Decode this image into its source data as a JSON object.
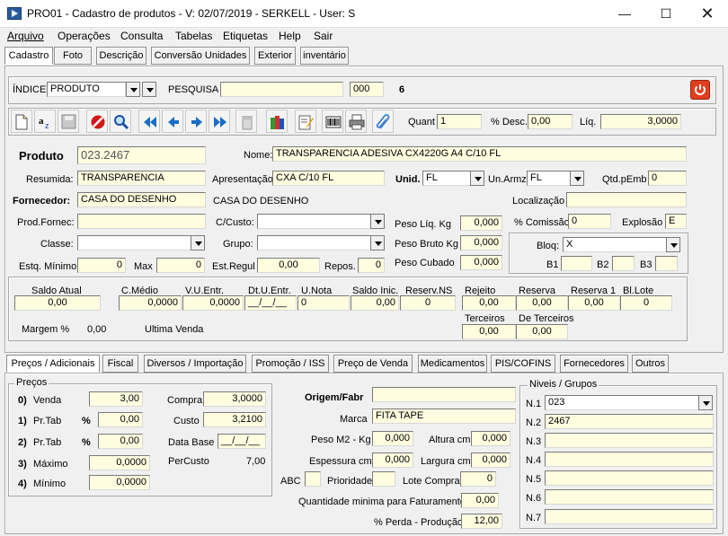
{
  "window": {
    "title": "PRO01 - Cadastro de produtos - V: 02/07/2019 - SERKELL - User: S"
  },
  "menu": [
    "Arquivo",
    "Operações",
    "Consulta",
    "Tabelas",
    "Etiquetas",
    "Help",
    "Sair"
  ],
  "top_tabs": [
    "Cadastro",
    "Foto",
    "Descrição",
    "Conversão Unidades",
    "Exterior",
    "inventário"
  ],
  "index_bar": {
    "indice_label": "ÍNDICE",
    "indice_value": "PRODUTO",
    "pesquisa_label": "PESQUISA",
    "pesquisa_value": "",
    "code_value": "000",
    "count": "6"
  },
  "toolbar": {
    "quant_label": "Quant",
    "quant_value": "1",
    "desc_label": "% Desc.",
    "desc_value": "0,00",
    "liq_label": "Líq.",
    "liq_value": "3,0000"
  },
  "product": {
    "produto_label": "Produto",
    "produto_value": "023.2467",
    "nome_label": "Nome:",
    "nome_value": "TRANSPARENCIA ADESIVA CX4220G A4 C/10 FL",
    "resumida_label": "Resumida:",
    "resumida_value": "TRANSPARENCIA",
    "apresentacao_label": "Apresentação",
    "apresentacao_value": "CXA C/10 FL",
    "unid_label": "Unid.",
    "unid_value": "FL",
    "unarmz_label": "Un.Armz",
    "unarmz_value": "FL",
    "qtdemb_label": "Qtd.pEmb",
    "qtdemb_value": "0",
    "fornecedor_label": "Fornecedor:",
    "fornecedor_value": "CASA DO DESENHO",
    "fornecedor_name": "CASA DO DESENHO",
    "localizacao_label": "Localização",
    "localizacao_value": "",
    "prodfornec_label": "Prod.Fornec:",
    "prodfornec_value": "",
    "ccusto_label": "C/Custo:",
    "ccusto_value": "",
    "pesoliq_label": "Peso Líq. Kg",
    "pesoliq_value": "0,000",
    "comissao_label": "% Comissão",
    "comissao_value": "0",
    "explosao_label": "Explosão",
    "explosao_value": "E",
    "classe_label": "Classe:",
    "classe_value": "",
    "grupo_label": "Grupo:",
    "grupo_value": "",
    "pesobruto_label": "Peso Bruto Kg",
    "pesobruto_value": "0,000",
    "bloq_label": "Bloq:",
    "bloq_value": "X",
    "estqmin_label": "Estq. Mínimo",
    "estqmin_value": "0",
    "max_label": "Max",
    "max_value": "0",
    "estregul_label": "Est.Regul",
    "estregul_value": "0,00",
    "repos_label": "Repos.",
    "repos_value": "0",
    "pesocubado_label": "Peso Cubado",
    "pesocubado_value": "0,000",
    "b1_label": "B1",
    "b2_label": "B2",
    "b3_label": "B3"
  },
  "stock": {
    "saldo_label": "Saldo Atual",
    "saldo_value": "0,00",
    "cmedio_label": "C.Médio",
    "cmedio_value": "0,0000",
    "vuentr_label": "V.U.Entr.",
    "vuentr_value": "0,0000",
    "dtuentr_label": "Dt.U.Entr.",
    "dtuentr_value": "__/__/__",
    "unota_label": "U.Nota",
    "unota_value": "0",
    "saldoinic_label": "Saldo Inic.",
    "saldoinic_value": "0,00",
    "reservns_label": "Reserv.NS",
    "reservns_value": "0",
    "rejeito_label": "Rejeito",
    "rejeito_value": "0,00",
    "reserva_label": "Reserva",
    "reserva_value": "0,00",
    "reserva1_label": "Reserva 1",
    "reserva1_value": "0,00",
    "bllote_label": "Bl.Lote",
    "bllote_value": "0",
    "terceiros_label": "Terceiros",
    "terceiros_value": "0,00",
    "deterceiros_label": "De Terceiros",
    "deterceiros_value": "0,00",
    "margem_label": "Margem %",
    "margem_value": "0,00",
    "ultima_label": "Ultima Venda"
  },
  "bottom_tabs": [
    "Preços / Adicionais",
    "Fiscal",
    "Diversos / Importação",
    "Promoção / ISS",
    "Preço de Venda",
    "Medicamentos",
    "PIS/COFINS",
    "Fornecedores",
    "Outros"
  ],
  "precos": {
    "group_label": "Preços",
    "rows": [
      {
        "num": "0)",
        "label": "Venda",
        "pct": "",
        "value": "3,00"
      },
      {
        "num": "1)",
        "label": "Pr.Tab",
        "pct": "%",
        "value": "0,00"
      },
      {
        "num": "2)",
        "label": "Pr.Tab",
        "pct": "%",
        "value": "0,00"
      },
      {
        "num": "3)",
        "label": "Máximo",
        "pct": "",
        "value": "0,0000"
      },
      {
        "num": "4)",
        "label": "Mínimo",
        "pct": "",
        "value": "0,0000"
      }
    ],
    "compra_label": "Compra",
    "compra_value": "3,0000",
    "custo_label": "Custo",
    "custo_value": "3,2100",
    "database_label": "Data Base",
    "database_value": "__/__/__",
    "percusto_label": "PerCusto",
    "percusto_value": "7,00"
  },
  "middle": {
    "origem_label": "Origem/Fabr",
    "origem_value": "",
    "marca_label": "Marca",
    "marca_value": "FITA TAPE",
    "pesom2_label": "Peso M2 - Kg",
    "pesom2_value": "0,000",
    "altura_label": "Altura cm",
    "altura_value": "0,000",
    "espessura_label": "Espessura cm",
    "espessura_value": "0,000",
    "largura_label": "Largura cm",
    "largura_value": "0,000",
    "abc_label": "ABC",
    "abc_value": "",
    "prioridade_label": "Prioridade",
    "prioridade_value": "",
    "lotecompra_label": "Lote Compra",
    "lotecompra_value": "0",
    "qtdmin_label": "Quantidade minima para Faturamento",
    "qtdmin_value": "0,00",
    "perda_label": "% Perda - Produção",
    "perda_value": "12,00"
  },
  "niveis": {
    "group_label": "Niveis / Grupos",
    "rows": [
      {
        "label": "N.1",
        "value": "023"
      },
      {
        "label": "N.2",
        "value": "2467"
      },
      {
        "label": "N.3",
        "value": ""
      },
      {
        "label": "N.4",
        "value": ""
      },
      {
        "label": "N.5",
        "value": ""
      },
      {
        "label": "N.6",
        "value": ""
      },
      {
        "label": "N.7",
        "value": ""
      }
    ]
  },
  "colors": {
    "field_bg": "#fffde0",
    "power_red": "#e23d1c",
    "window_bg": "#f0f0f0"
  }
}
